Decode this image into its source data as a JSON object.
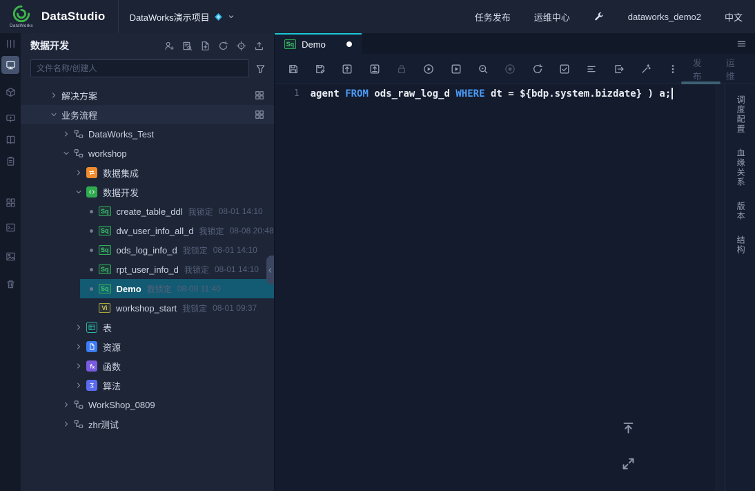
{
  "header": {
    "logo_caption": "DataWorks",
    "product_title": "DataStudio",
    "project_name": "DataWorks演示项目",
    "menu_task_publish": "任务发布",
    "menu_ops_center": "运维中心",
    "account": "dataworks_demo2",
    "language": "中文"
  },
  "left_panel": {
    "title": "数据开发",
    "search_placeholder": "文件名称/创建人",
    "tree": [
      {
        "label": "解决方案"
      },
      {
        "label": "业务流程"
      },
      {
        "label": "DataWorks_Test"
      },
      {
        "label": "workshop"
      },
      {
        "label": "数据集成"
      },
      {
        "label": "数据开发"
      },
      {
        "label": "create_table_ddl",
        "badge": "Sq",
        "lock": "我锁定",
        "time": "08-01 14:10"
      },
      {
        "label": "dw_user_info_all_d",
        "badge": "Sq",
        "lock": "我锁定",
        "time": "08-08 20:48"
      },
      {
        "label": "ods_log_info_d",
        "badge": "Sq",
        "lock": "我锁定",
        "time": "08-01 14:10"
      },
      {
        "label": "rpt_user_info_d",
        "badge": "Sq",
        "lock": "我锁定",
        "time": "08-01 14:10"
      },
      {
        "label": "Demo",
        "badge": "Sq",
        "lock": "我锁定",
        "time": "08-09 11:40"
      },
      {
        "label": "workshop_start",
        "badge": "Vi",
        "lock": "我锁定",
        "time": "08-01 09:37"
      },
      {
        "label": "表"
      },
      {
        "label": "资源"
      },
      {
        "label": "函数"
      },
      {
        "label": "算法"
      },
      {
        "label": "WorkShop_0809"
      },
      {
        "label": "zhr测试"
      }
    ]
  },
  "editor_tab": {
    "badge": "Sq",
    "label": "Demo"
  },
  "toolbar": {
    "publish": "发布",
    "ops": "运维"
  },
  "editor": {
    "line_number": "1",
    "code_tokens": [
      {
        "text": "agent ",
        "type": "plain"
      },
      {
        "text": "FROM",
        "type": "keyword"
      },
      {
        "text": " ods_raw_log_d ",
        "type": "plain"
      },
      {
        "text": "WHERE",
        "type": "keyword"
      },
      {
        "text": " dt = ",
        "type": "plain"
      },
      {
        "text": "${bdp.system.bizdate}",
        "type": "variable"
      },
      {
        "text": " ) a;",
        "type": "plain"
      }
    ]
  },
  "right_rail": {
    "tabs": [
      "调度配置",
      "血缘关系",
      "版本",
      "结构"
    ]
  }
}
